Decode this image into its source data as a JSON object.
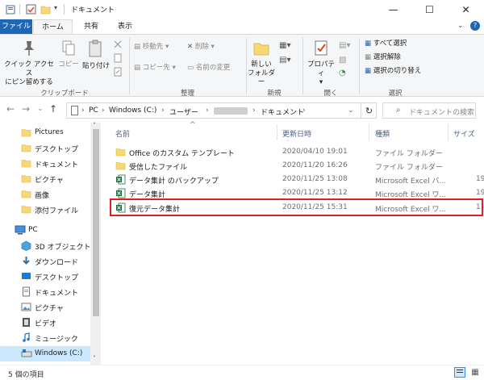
{
  "window": {
    "title": "ドキュメント",
    "minimize": "—",
    "maximize": "☐",
    "close": "✕"
  },
  "tabs": {
    "file": "ファイル",
    "home": "ホーム",
    "share": "共有",
    "view": "表示"
  },
  "ribbon": {
    "pin": [
      "クイック アクセス",
      "にピン留めする"
    ],
    "copy": "コピー",
    "paste": "貼り付け",
    "clipboard_label": "クリップボード",
    "move_to": "移動先",
    "copy_to": "コピー先",
    "delete": "削除",
    "rename": "名前の変更",
    "organize_label": "整理",
    "new_folder": [
      "新しい",
      "フォルダー"
    ],
    "new_label": "新規",
    "properties": "プロパティ",
    "open_label": "開く",
    "select_all": "すべて選択",
    "select_none": "選択解除",
    "invert_selection": "選択の切り替え",
    "select_label": "選択"
  },
  "address": {
    "segments": [
      "PC",
      "Windows (C:)",
      "ユーザー",
      "ドキュメント"
    ],
    "search_placeholder": "ドキュメントの検索"
  },
  "navpane": {
    "items": [
      {
        "label": "Pictures",
        "icon": "folder-icon"
      },
      {
        "label": "デスクトップ",
        "icon": "folder-icon"
      },
      {
        "label": "ドキュメント",
        "icon": "folder-icon"
      },
      {
        "label": "ピクチャ",
        "icon": "folder-icon"
      },
      {
        "label": "画像",
        "icon": "folder-icon"
      },
      {
        "label": "添付ファイル",
        "icon": "folder-icon"
      },
      {
        "label": "PC",
        "icon": "pc-icon"
      },
      {
        "label": "3D オブジェクト",
        "icon": "3d-objects-icon"
      },
      {
        "label": "ダウンロード",
        "icon": "download-icon"
      },
      {
        "label": "デスクトップ",
        "icon": "desktop-icon"
      },
      {
        "label": "ドキュメント",
        "icon": "document-icon"
      },
      {
        "label": "ピクチャ",
        "icon": "pictures-icon"
      },
      {
        "label": "ビデオ",
        "icon": "video-icon"
      },
      {
        "label": "ミュージック",
        "icon": "music-icon"
      },
      {
        "label": "Windows (C:)",
        "icon": "drive-icon"
      }
    ]
  },
  "columns": {
    "name": "名前",
    "date": "更新日時",
    "type": "種類",
    "size": "サイズ"
  },
  "files": [
    {
      "name": "Office のカスタム テンプレート",
      "date": "2020/04/10 19:01",
      "type": "ファイル フォルダー",
      "size": "",
      "icon": "folder-icon"
    },
    {
      "name": "受信したファイル",
      "date": "2020/11/20 16:26",
      "type": "ファイル フォルダー",
      "size": "",
      "icon": "folder-icon"
    },
    {
      "name": "データ集計 のバックアップ",
      "date": "2020/11/25 13:08",
      "type": "Microsoft Excel バ...",
      "size": "19",
      "icon": "excel-icon"
    },
    {
      "name": "データ集計",
      "date": "2020/11/25 13:12",
      "type": "Microsoft Excel ワ...",
      "size": "19",
      "icon": "excel-icon"
    },
    {
      "name": "復元データ集計",
      "date": "2020/11/25 15:31",
      "type": "Microsoft Excel ワ...",
      "size": "1",
      "icon": "excel-icon"
    }
  ],
  "status": {
    "count": "5 個の項目"
  },
  "colors": {
    "file_tab": "#1e66b6",
    "highlight": "#e0201e",
    "selected": "#cce8ff",
    "folder": "#f8d775"
  }
}
